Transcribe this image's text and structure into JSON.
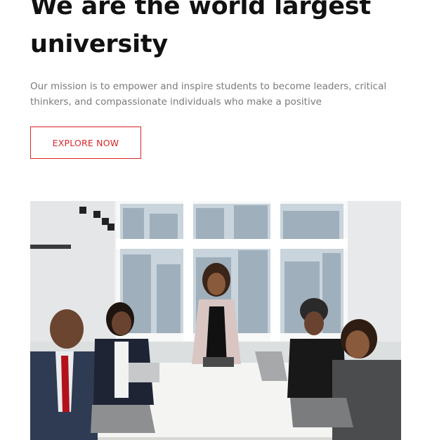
{
  "hero": {
    "title_line1": "We are the world largest",
    "title_line2": "university",
    "description": "Our mission is to empower and inspire students to become leaders, critical thinkers, and compassionate individuals who make a positive",
    "cta_label": "EXPLORE NOW"
  },
  "colors": {
    "accent": "#d9262a",
    "heading": "#111111",
    "body_text": "#7a7a7a"
  },
  "image": {
    "subject": "meeting-photo"
  }
}
